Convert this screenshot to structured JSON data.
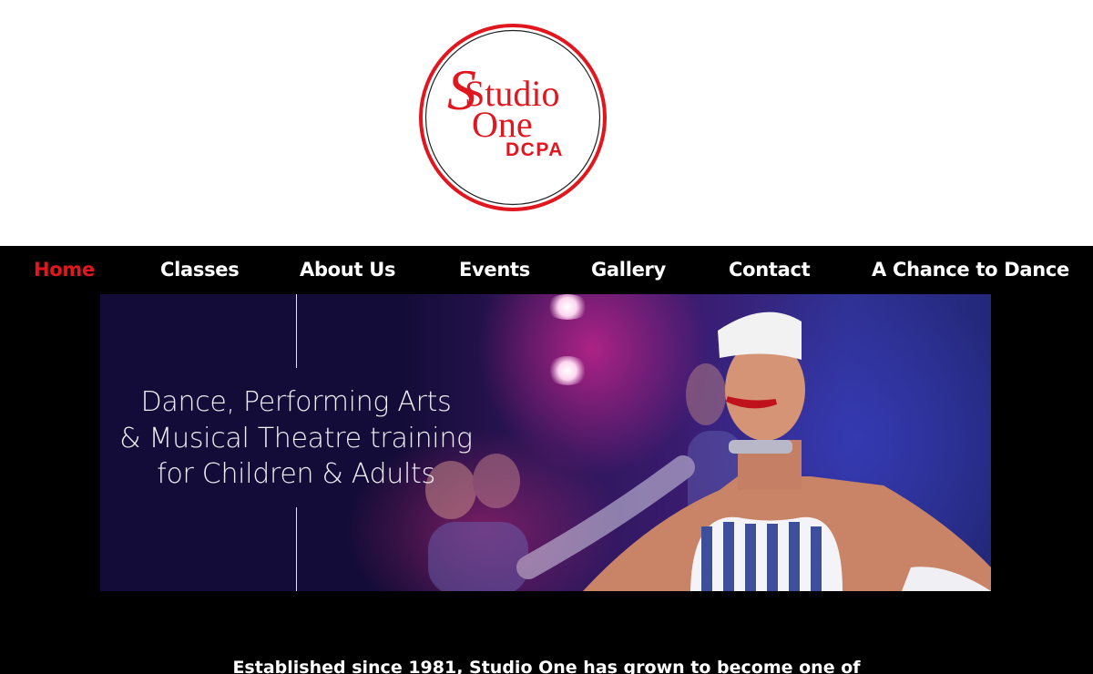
{
  "logo": {
    "line1": "Studio",
    "line2": "One",
    "line3": "DCPA",
    "color": "#e0171f"
  },
  "nav": {
    "items": [
      {
        "label": "Home",
        "active": true
      },
      {
        "label": "Classes"
      },
      {
        "label": "About Us"
      },
      {
        "label": "Events"
      },
      {
        "label": "Gallery"
      },
      {
        "label": "Contact"
      },
      {
        "label": "A Chance to Dance"
      }
    ]
  },
  "hero": {
    "line1": "Dance, Performing Arts",
    "line2": "& Musical Theatre training",
    "line3": "for Children & Adults"
  },
  "intro": {
    "text": "Established since 1981, Studio One has grown to become one of"
  },
  "colors": {
    "accent": "#e0171f",
    "nav_bg": "#000000",
    "hero_panel": "#140c38"
  }
}
